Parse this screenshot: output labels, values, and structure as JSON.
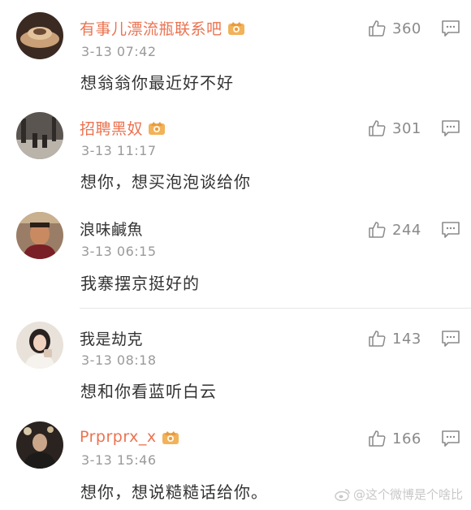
{
  "comments": [
    {
      "username": "有事儿漂流瓶联系吧",
      "vip": true,
      "time": "3-13 07:42",
      "text": "想翁翁你最近好不好",
      "likes": "360"
    },
    {
      "username": "招聘黑奴",
      "vip": true,
      "time": "3-13 11:17",
      "text": "想你，想买泡泡谈给你",
      "likes": "301"
    },
    {
      "username": "浪味鹹魚",
      "vip": false,
      "time": "3-13 06:15",
      "text": "我寨摆京挺好的",
      "likes": "244"
    },
    {
      "username": "我是劫克",
      "vip": false,
      "time": "3-13 08:18",
      "text": "想和你看蓝听白云",
      "likes": "143"
    },
    {
      "username": "Prprprx_x",
      "vip": true,
      "time": "3-13 15:46",
      "text": "想你，想说糙糙话给你。",
      "likes": "166"
    }
  ],
  "icons": {
    "like": "thumbs-up-icon",
    "reply": "comment-icon",
    "vip": "vip-crown-badge-icon",
    "watermark": "weibo-logo-icon"
  },
  "colors": {
    "vip_name": "#eb7350",
    "plain_name": "#333333",
    "timestamp": "#9a9a9a",
    "icon": "#8a8a8a"
  },
  "watermark": {
    "text": "@这个微博是个啥比"
  }
}
